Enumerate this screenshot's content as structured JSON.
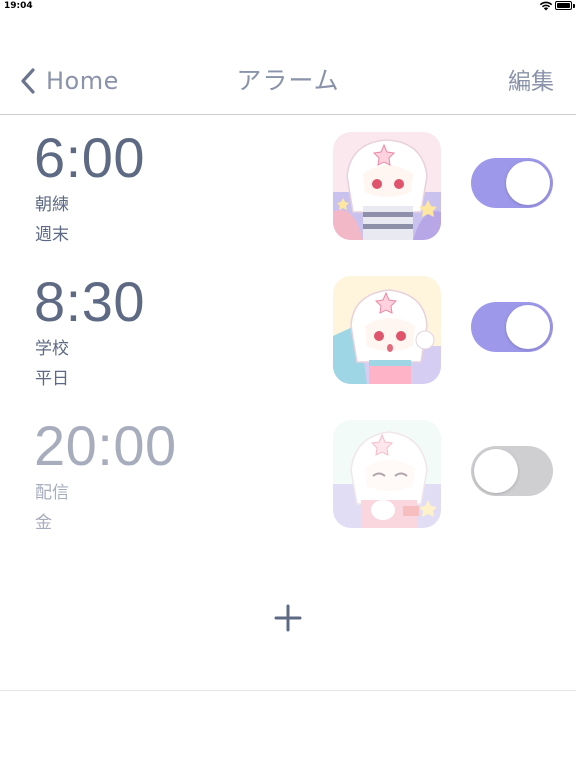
{
  "status_bar": {
    "time": "19:04"
  },
  "nav": {
    "back_label": "Home",
    "title": "アラーム",
    "edit_label": "編集"
  },
  "alarms": [
    {
      "time": "6:00",
      "label": "朝練",
      "repeat": "週末",
      "enabled": true
    },
    {
      "time": "8:30",
      "label": "学校",
      "repeat": "平日",
      "enabled": true
    },
    {
      "time": "20:00",
      "label": "配信",
      "repeat": "金",
      "enabled": false
    }
  ],
  "colors": {
    "accent": "#9d98ea",
    "text": "#5e6a84",
    "text_disabled": "#a7adbd",
    "nav_text": "#8a93aa",
    "toggle_off": "#cfcfd2"
  }
}
